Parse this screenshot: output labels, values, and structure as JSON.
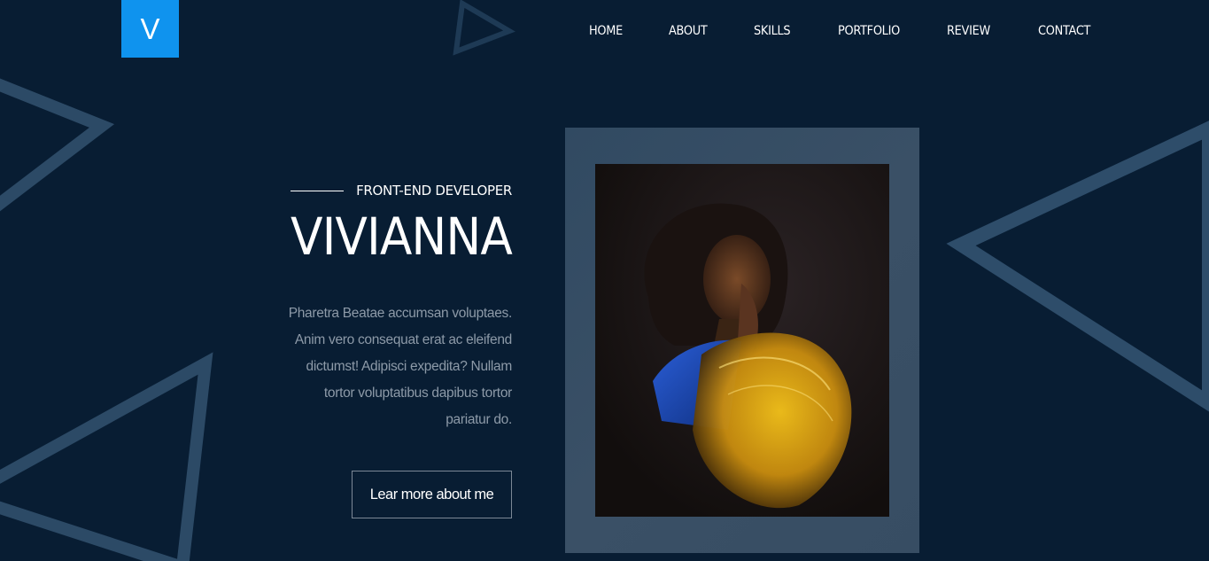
{
  "logo": {
    "letter": "V"
  },
  "nav": {
    "items": [
      {
        "label": "HOME"
      },
      {
        "label": "ABOUT"
      },
      {
        "label": "SKILLS"
      },
      {
        "label": "PORTFOLIO"
      },
      {
        "label": "REVIEW"
      },
      {
        "label": "CONTACT"
      }
    ]
  },
  "hero": {
    "eyebrow": "FRONT-END DEVELOPER",
    "name": "VIVIANNA",
    "bio": "Pharetra Beatae accumsan voluptaes. Anim vero consequat erat ac eleifend dictumst! Adipisci expedita? Nullam tortor voluptatibus dapibus tortor pariatur do.",
    "button_label": "Lear more about me"
  },
  "colors": {
    "background": "#081d33",
    "accent": "#0f93ee",
    "shape": "#2a4a66",
    "frame": "#374d63"
  },
  "photo": {
    "subject": "portrait-photo"
  }
}
